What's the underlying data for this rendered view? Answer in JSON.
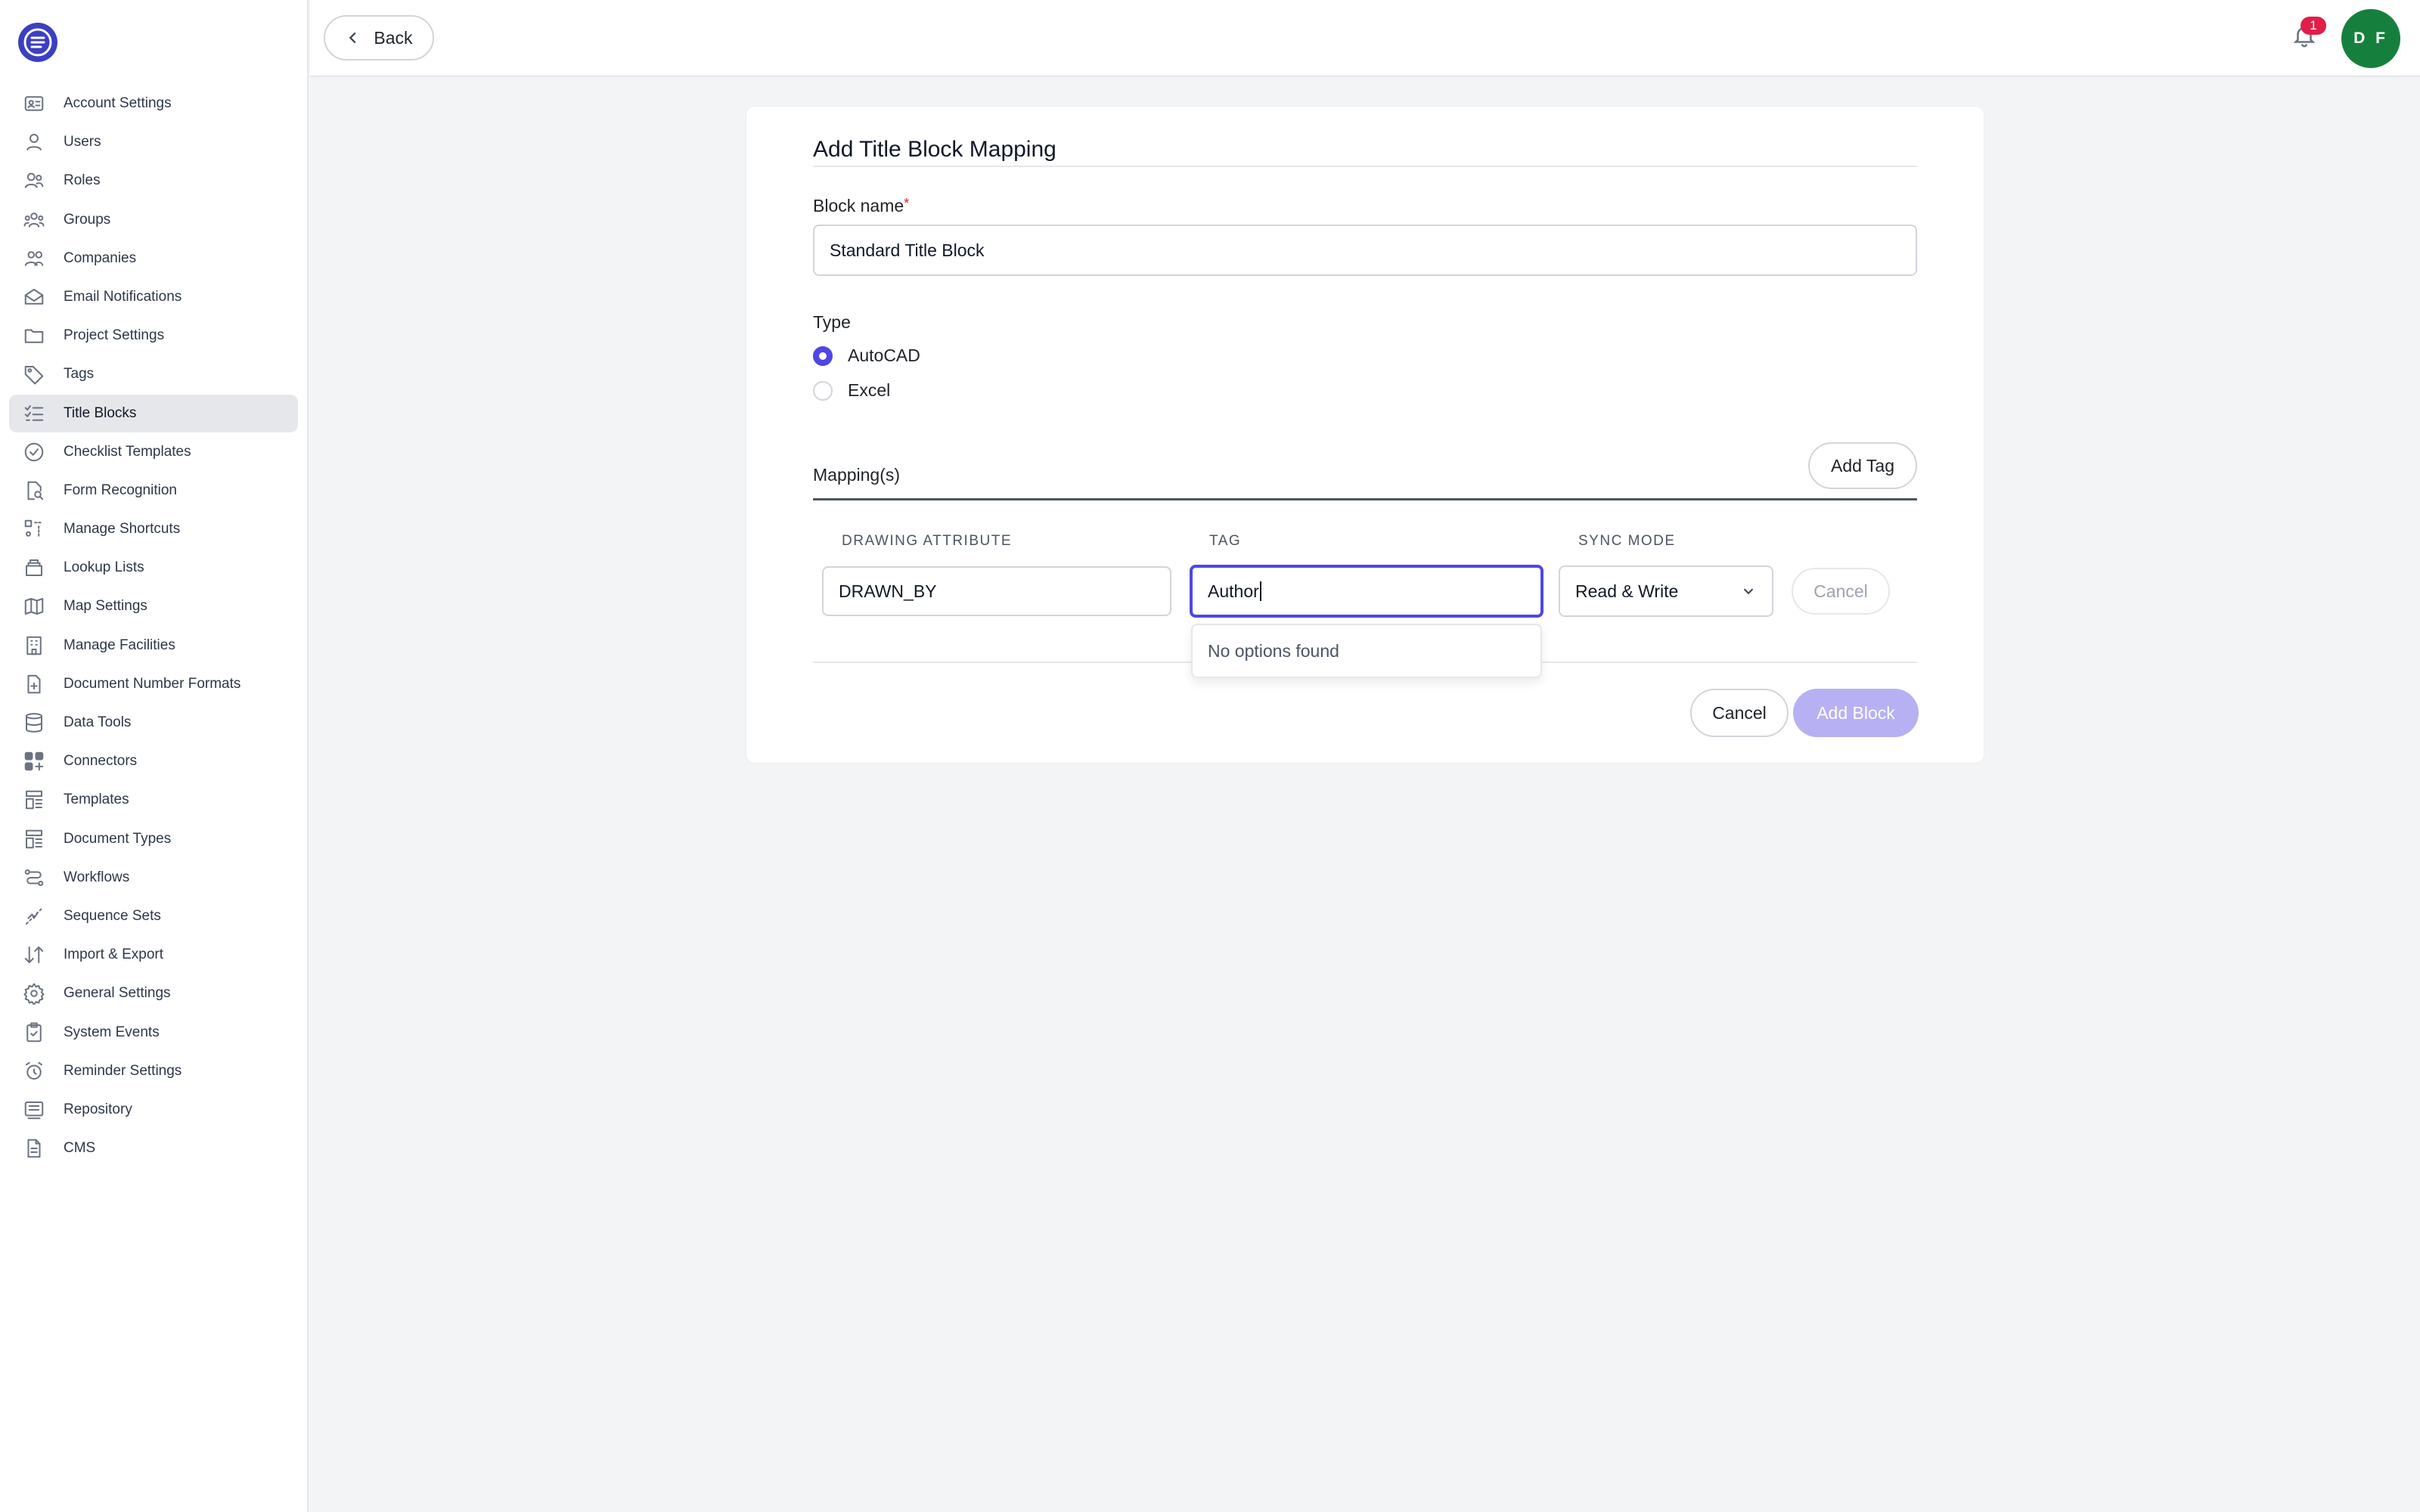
{
  "sidebar": {
    "items": [
      {
        "label": "Account Settings",
        "icon": "id-card-icon"
      },
      {
        "label": "Users",
        "icon": "user-icon"
      },
      {
        "label": "Roles",
        "icon": "users-icon"
      },
      {
        "label": "Groups",
        "icon": "users-group-icon"
      },
      {
        "label": "Companies",
        "icon": "users-company-icon"
      },
      {
        "label": "Email Notifications",
        "icon": "mail-open-icon"
      },
      {
        "label": "Project Settings",
        "icon": "folder-icon"
      },
      {
        "label": "Tags",
        "icon": "tag-icon"
      },
      {
        "label": "Title Blocks",
        "icon": "list-check-icon",
        "active": true
      },
      {
        "label": "Checklist Templates",
        "icon": "check-circle-icon"
      },
      {
        "label": "Form Recognition",
        "icon": "file-search-icon"
      },
      {
        "label": "Manage Shortcuts",
        "icon": "shortcuts-icon"
      },
      {
        "label": "Lookup Lists",
        "icon": "stack-icon"
      },
      {
        "label": "Map Settings",
        "icon": "map-icon"
      },
      {
        "label": "Manage Facilities",
        "icon": "building-icon"
      },
      {
        "label": "Document Number Formats",
        "icon": "file-plus-icon"
      },
      {
        "label": "Data Tools",
        "icon": "database-icon"
      },
      {
        "label": "Connectors",
        "icon": "apps-icon"
      },
      {
        "label": "Templates",
        "icon": "template-icon"
      },
      {
        "label": "Document Types",
        "icon": "document-types-icon"
      },
      {
        "label": "Workflows",
        "icon": "route-icon"
      },
      {
        "label": "Sequence Sets",
        "icon": "sequence-icon"
      },
      {
        "label": "Import & Export",
        "icon": "arrows-sort-icon"
      },
      {
        "label": "General Settings",
        "icon": "gear-icon"
      },
      {
        "label": "System Events",
        "icon": "clipboard-check-icon"
      },
      {
        "label": "Reminder Settings",
        "icon": "alarm-icon"
      },
      {
        "label": "Repository",
        "icon": "archive-icon"
      },
      {
        "label": "CMS",
        "icon": "file-text-icon"
      }
    ]
  },
  "topbar": {
    "back_label": "Back",
    "notification_count": "1",
    "avatar_initials": "D F"
  },
  "form": {
    "title": "Add Title Block Mapping",
    "block_name_label": "Block name",
    "required_mark": "*",
    "block_name_value": "Standard Title Block",
    "type_label": "Type",
    "type_options": [
      {
        "label": "AutoCAD",
        "checked": true
      },
      {
        "label": "Excel",
        "checked": false
      }
    ],
    "mappings_label": "Mapping(s)",
    "add_tag_label": "Add Tag",
    "columns": {
      "drawing_attribute": "Drawing Attribute",
      "tag": "Tag",
      "sync_mode": "Sync Mode"
    },
    "row": {
      "drawing_attribute_value": "DRAWN_BY",
      "tag_value": "Author",
      "sync_mode_value": "Read & Write",
      "cancel_label": "Cancel"
    },
    "dropdown_empty_text": "No options found",
    "cancel_label": "Cancel",
    "submit_label": "Add Block"
  },
  "colors": {
    "accent": "#4f46e5",
    "avatar_bg": "#15803d",
    "badge": "#e11d48",
    "submit_disabled": "#b7b0f3"
  }
}
